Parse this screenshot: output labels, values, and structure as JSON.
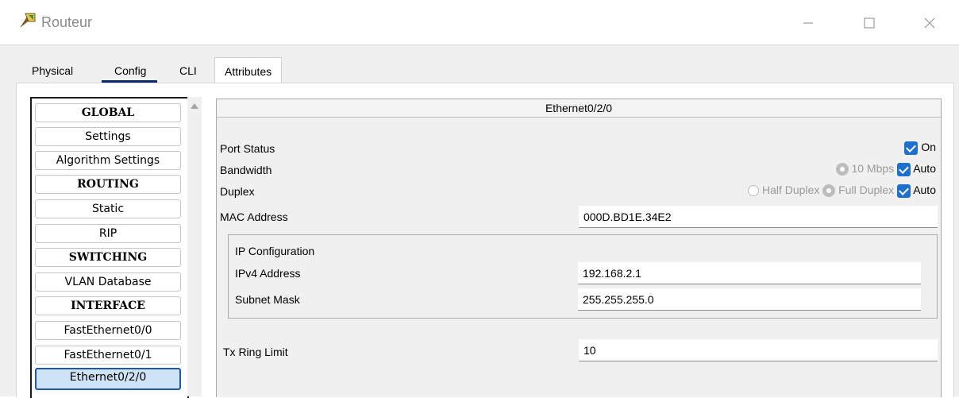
{
  "window": {
    "title": "Routeur",
    "icon": "router-app-icon",
    "controls": [
      "minimize-icon",
      "maximize-icon",
      "close-icon"
    ]
  },
  "tabs": [
    {
      "label": "Physical"
    },
    {
      "label": "Config",
      "active": true
    },
    {
      "label": "CLI"
    },
    {
      "label": "Attributes"
    }
  ],
  "sidebar": {
    "items": [
      {
        "label": "GLOBAL",
        "type": "header"
      },
      {
        "label": "Settings"
      },
      {
        "label": "Algorithm Settings"
      },
      {
        "label": "ROUTING",
        "type": "header"
      },
      {
        "label": "Static"
      },
      {
        "label": "RIP"
      },
      {
        "label": "SWITCHING",
        "type": "header"
      },
      {
        "label": "VLAN Database"
      },
      {
        "label": "INTERFACE",
        "type": "header"
      },
      {
        "label": "FastEthernet0/0"
      },
      {
        "label": "FastEthernet0/1"
      },
      {
        "label": "Ethernet0/2/0",
        "selected": true
      }
    ]
  },
  "interface": {
    "title": "Ethernet0/2/0",
    "port_status": {
      "label": "Port Status",
      "on_label": "On",
      "checked": true
    },
    "bandwidth": {
      "label": "Bandwidth",
      "option_label": "10 Mbps",
      "auto_label": "Auto",
      "auto_checked": true
    },
    "duplex": {
      "label": "Duplex",
      "half_label": "Half Duplex",
      "full_label": "Full Duplex",
      "auto_label": "Auto",
      "auto_checked": true
    },
    "mac": {
      "label": "MAC Address",
      "value": "000D.BD1E.34E2"
    },
    "ip_config": {
      "title": "IP Configuration",
      "ipv4_label": "IPv4 Address",
      "ipv4_value": "192.168.2.1",
      "subnet_label": "Subnet Mask",
      "subnet_value": "255.255.255.0"
    },
    "tx_ring": {
      "label": "Tx Ring Limit",
      "value": "10"
    }
  },
  "colors": {
    "accent": "#1f6fcf",
    "tab_underline": "#0b2a6a",
    "selected_bg": "#cfe3f7"
  }
}
